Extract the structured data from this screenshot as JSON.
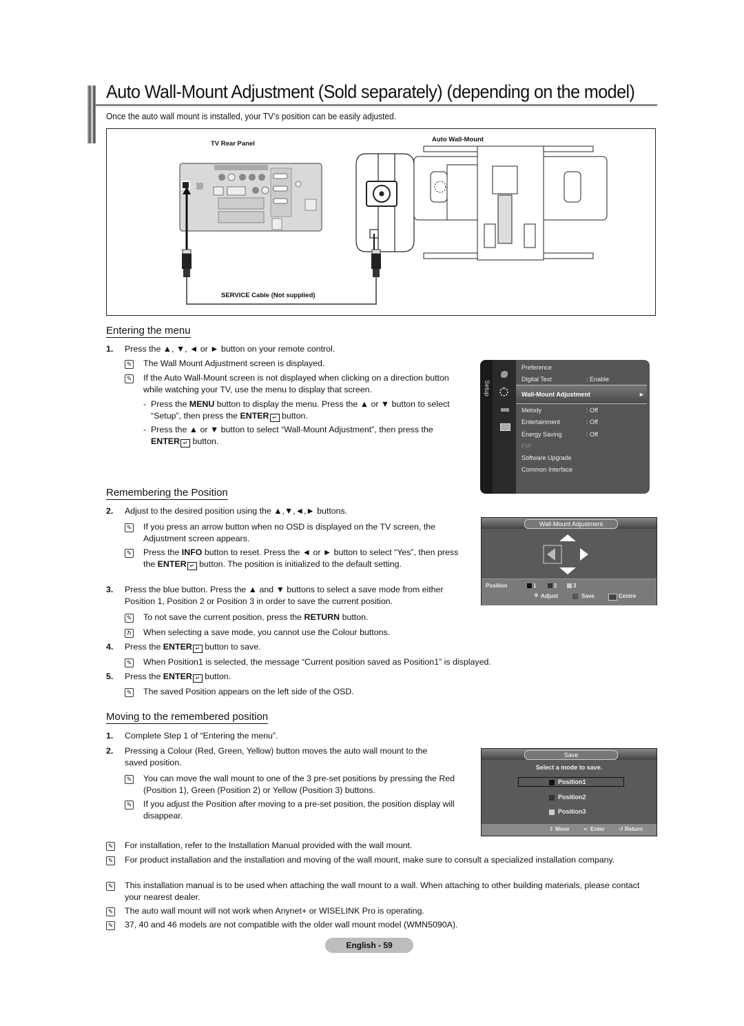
{
  "page": {
    "title": "Auto Wall-Mount Adjustment (Sold separately) (depending on the model)",
    "intro": "Once the auto wall mount is installed, your TV’s position can be easily adjusted.",
    "page_label": "English - 59"
  },
  "figure": {
    "rear_panel_label": "TV Rear Panel",
    "wall_mount_label": "Auto Wall-Mount",
    "cable_label": "SERVICE Cable  (Not supplied)"
  },
  "entering": {
    "heading": "Entering the menu",
    "step1_num": "1.",
    "step1_text": "Press the ▲, ▼, ◄ or ► button on your remote control.",
    "note1": "The Wall Mount Adjustment screen is displayed.",
    "note2": "If the Auto Wall-Mount screen is not displayed when clicking on a direction button while watching your TV, use the menu to display that screen.",
    "sub1_a": "Press the ",
    "sub1_b": "MENU",
    "sub1_c": " button to display the menu. Press the ▲ or ▼ button to select “Setup”, then press the ",
    "sub1_d": "ENTER",
    "sub1_e": " button.",
    "sub2_a": "Press the ▲ or ▼ button to select “Wall-Mount Adjustment”, then press the ",
    "sub2_b": "ENTER",
    "sub2_c": " button."
  },
  "setup_menu": {
    "tab_label": "Setup",
    "items": [
      {
        "label": "Preference",
        "value": ""
      },
      {
        "label": "Digital Text",
        "value": ": Enable"
      },
      {
        "label": "Wall-Mount Adjustment",
        "value": "►"
      },
      {
        "label": "Melody",
        "value": ": Off"
      },
      {
        "label": "Entertainment",
        "value": ": Off"
      },
      {
        "label": "Energy Saving",
        "value": ": Off"
      },
      {
        "label": "PIP",
        "value": ""
      },
      {
        "label": "Software Upgrade",
        "value": ""
      },
      {
        "label": "Common Interface",
        "value": ""
      }
    ]
  },
  "remembering": {
    "heading": "Remembering the Position",
    "step2_num": "2.",
    "step2_text": "Adjust to the desired position using the ▲,▼,◄,► buttons.",
    "note1": "If you press an arrow button when no OSD is displayed on the TV screen, the Adjustment screen appears.",
    "note2_a": "Press the ",
    "note2_b": "INFO",
    "note2_c": " button to reset. Press the ◄ or ► button to select “Yes”, then press the ",
    "note2_d": "ENTER",
    "note2_e": " button. The position is initialized to the default setting.",
    "step3_num": "3.",
    "step3_text": "Press the blue button. Press the ▲ and ▼ buttons to select a save mode from either Position 1, Position 2 or Position 3 in order to save the current position.",
    "note3_a": "To not save the current position, press the ",
    "note3_b": "RETURN",
    "note3_c": " button.",
    "note4": "When selecting a save mode, you cannot use the Colour buttons.",
    "step4_num": "4.",
    "step4_a": "Press the ",
    "step4_b": "ENTER",
    "step4_c": " button to save.",
    "note5": "When Position1 is selected, the message “Current position saved as Position1” is displayed.",
    "step5_num": "5.",
    "step5_a": "Press the ",
    "step5_b": "ENTER",
    "step5_c": " button.",
    "note6": "The saved Position appears on the left side of the OSD."
  },
  "adjust_osd": {
    "title": "Wall-Mount Adjustment",
    "position_label": "Position",
    "positions": [
      "1",
      "2",
      "3"
    ],
    "adjust_label": "Adjust",
    "save_label": "Save",
    "centre_label": "Centre"
  },
  "moving": {
    "heading": "Moving to the remembered position",
    "step1_num": "1.",
    "step1_text": "Complete Step 1 of “Entering the menu”.",
    "step2_num": "2.",
    "step2_text": "Pressing a Colour (Red, Green, Yellow) button moves the auto wall mount to the saved position.",
    "note1": "You can move the wall mount to one of the 3 pre-set positions by pressing the Red (Position 1), Green (Position 2) or Yellow (Position 3) buttons.",
    "note2": "If you adjust the Position after moving to a pre-set position, the position display will disappear."
  },
  "save_osd": {
    "title": "Save",
    "prompt": "Select a mode to save.",
    "options": [
      "Position1",
      "Position2",
      "Position3"
    ],
    "move_label": "Move",
    "enter_label": "Enter",
    "return_label": "Return"
  },
  "bottom_notes": [
    "For installation, refer to the Installation Manual provided with the wall mount.",
    "For product installation and the installation and moving of the wall mount, make sure to consult a specialized installation company.",
    "This installation manual is to be used when attaching the wall mount to a wall. When attaching to other building materials, please contact your nearest dealer.",
    "The auto wall mount will not work when Anynet+ or WISELINK Pro is operating.",
    "37, 40 and 46 models are not compatible with the older wall mount model (WMN5090A)."
  ],
  "icons": {
    "note": "✎",
    "caution": "ℏ"
  }
}
